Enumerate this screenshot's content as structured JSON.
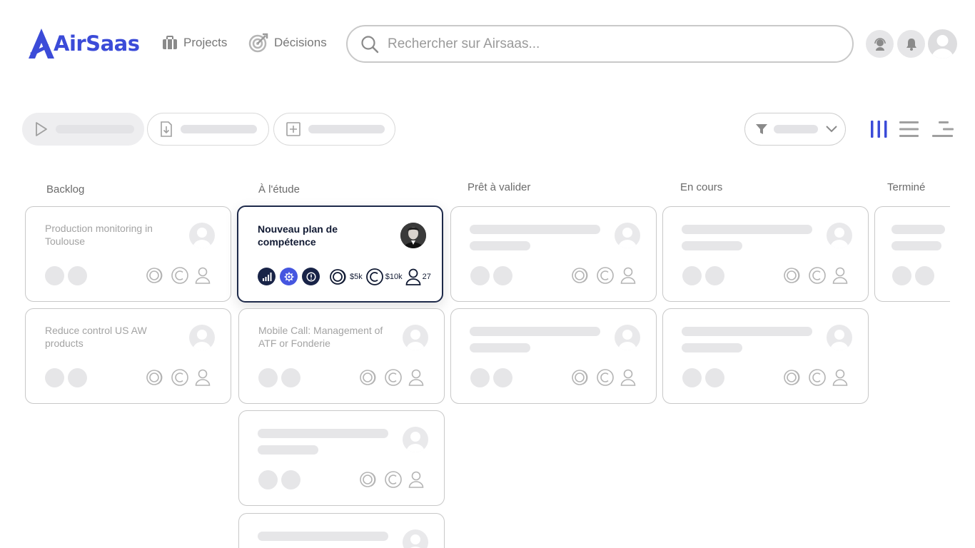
{
  "brand": {
    "name": "AirSaas",
    "color": "#3b4bd8"
  },
  "nav": {
    "projects": {
      "label": "Projects",
      "icon": "briefcase-icon"
    },
    "decisions": {
      "label": "Décisions",
      "icon": "target-icon"
    }
  },
  "search": {
    "placeholder": "Rechercher sur Airsaas...",
    "value": ""
  },
  "toolbar": {
    "pills": [
      {
        "icon": "play-icon"
      },
      {
        "icon": "export-icon"
      },
      {
        "icon": "add-icon"
      }
    ],
    "filter": {
      "icon": "filter-icon"
    },
    "views": [
      "kanban-view-icon",
      "list-view-icon",
      "gantt-view-icon"
    ],
    "active_view": "kanban"
  },
  "columns": [
    {
      "title": "Backlog"
    },
    {
      "title": "À l'étude"
    },
    {
      "title": "Prêt à valider"
    },
    {
      "title": "En cours"
    },
    {
      "title": "Terminé"
    }
  ],
  "cards": {
    "backlog": [
      {
        "title": "Production monitoring in Toulouse"
      },
      {
        "title": "Reduce control US AW products"
      }
    ],
    "etude": [
      {
        "title": "Nouveau plan de compétence",
        "active": true,
        "budget": "$5k",
        "cost": "$10k",
        "people": "27"
      },
      {
        "title": "Mobile Call: Management of ATF or Fonderie"
      }
    ]
  },
  "colors": {
    "accent": "#3b4bd8",
    "dark": "#182347",
    "border": "#c8c8c8"
  }
}
